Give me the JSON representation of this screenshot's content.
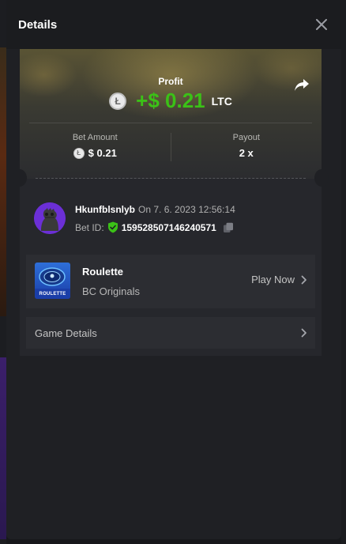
{
  "modal": {
    "title": "Details"
  },
  "profit": {
    "label": "Profit",
    "value": "+$ 0.21",
    "currency": "LTC",
    "coin_glyph": "Ł"
  },
  "stats": {
    "bet_amount_label": "Bet Amount",
    "bet_amount_value": "$ 0.21",
    "payout_label": "Payout",
    "payout_value": "2 x"
  },
  "bet": {
    "username": "Hkunfblsnlyb",
    "date": "On 7. 6. 2023 12:56:14",
    "id_label": "Bet ID:",
    "id_value": "159528507146240571"
  },
  "game": {
    "name": "Roulette",
    "provider": "BC Originals",
    "thumb_text": "ROULETTE",
    "play_label": "Play Now"
  },
  "details": {
    "label": "Game Details"
  },
  "colors": {
    "accent_green": "#3bc117",
    "avatar_bg": "#6b2fd6",
    "modal_bg": "#1f2024",
    "card_bg": "#26272c"
  },
  "icons": [
    "close-icon",
    "share-icon",
    "litecoin-icon",
    "shield-check-icon",
    "copy-icon",
    "chevron-right-icon"
  ]
}
